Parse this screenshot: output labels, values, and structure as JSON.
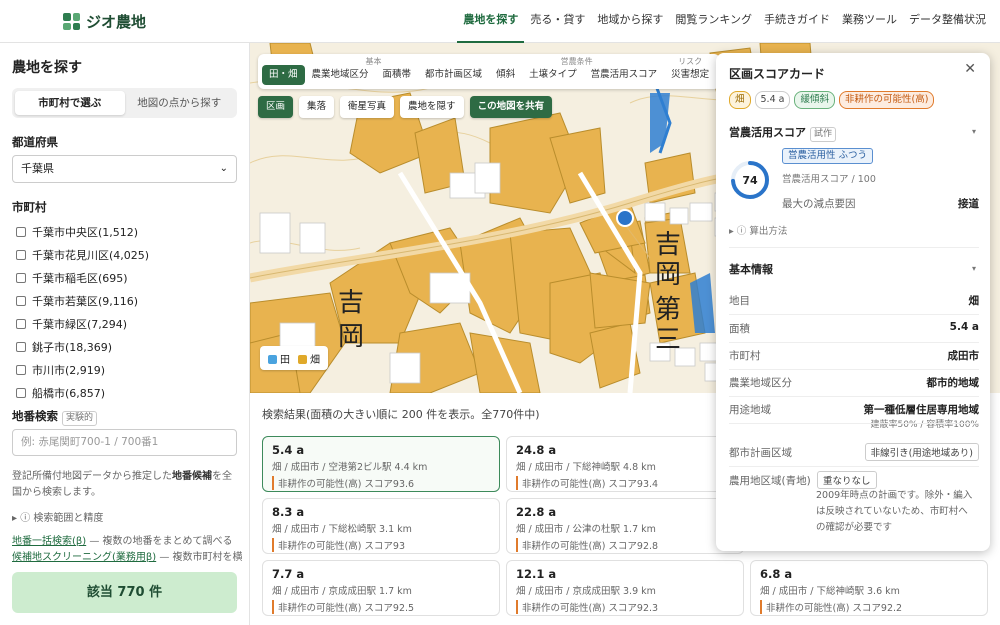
{
  "header": {
    "logo": "ジオ農地",
    "nav": [
      {
        "label": "農地を探す",
        "active": true
      },
      {
        "label": "売る・貸す"
      },
      {
        "label": "地域から探す"
      },
      {
        "label": "閲覧ランキング"
      },
      {
        "label": "手続きガイド"
      },
      {
        "label": "業務ツール"
      },
      {
        "label": "データ整備状況"
      }
    ]
  },
  "sidebar": {
    "title": "農地を探す",
    "modes": [
      "市町村で選ぶ",
      "地図の点から探す"
    ],
    "pref_label": "都道府県",
    "pref_value": "千葉県",
    "city_label": "市町村",
    "cities": [
      "千葉市中央区(1,512)",
      "千葉市花見川区(4,025)",
      "千葉市稲毛区(695)",
      "千葉市若葉区(9,116)",
      "千葉市緑区(7,294)",
      "銚子市(18,369)",
      "市川市(2,919)",
      "船橋市(6,857)"
    ],
    "lot_label": "地番検索",
    "lot_tag": "実験的",
    "lot_placeholder": "例: 赤尾関町700-1 / 700番1",
    "note_pre": "登記所備付地図データから推定した",
    "note_bold": "地番候補",
    "note_post": "を全国から検索します。",
    "detail": "ⓘ 検索範囲と精度",
    "link1": "地番一括検索(β)",
    "link1_rest": " — 複数の地番をまとめて調べる",
    "link2": "候補地スクリーニング(業務用β)",
    "link2_rest": " — 複数市町村を横断して",
    "hits": "該当 770 件"
  },
  "map": {
    "groups": [
      {
        "label": "基本",
        "items": [
          "田・畑",
          "農業地域区分",
          "面積帯",
          "都市計画区域"
        ]
      },
      {
        "label": "営農条件",
        "items": [
          "傾斜",
          "土壌タイプ",
          "営農活用スコア"
        ]
      },
      {
        "label": "リスク",
        "items": [
          "災害想定"
        ]
      }
    ],
    "row2": [
      "区画",
      "集落",
      "衛星写真",
      "農地を隠す",
      "この地図を共有"
    ],
    "labels": [
      "吉",
      "岡",
      "吉",
      "岡",
      "第",
      "三"
    ],
    "legend": [
      {
        "label": "田",
        "color": "#4aa3df"
      },
      {
        "label": "畑",
        "color": "#e0a92a"
      }
    ],
    "field_color": "#e8b34f",
    "water_color": "#2f7fd1",
    "road_color": "#f2d9a6"
  },
  "results": {
    "heading": "検索結果(面積の大きい順に 200 件を表示。全770件中)",
    "cards": [
      {
        "area": "5.4 a",
        "meta": "畑 / 成田市 / 空港第2ビル駅 4.4 km",
        "risk": "非耕作の可能性(高) スコア93.6"
      },
      {
        "area": "24.8 a",
        "meta": "畑 / 成田市 / 下総神崎駅 4.8 km",
        "risk": "非耕作の可能性(高) スコア93.4"
      },
      {
        "area": "8.3 a",
        "meta": "畑 / 成田市 / 下総松崎駅 3.1 km",
        "risk": "非耕作の可能性(高) スコア93"
      },
      {
        "area": "22.8 a",
        "meta": "畑 / 成田市 / 公津の杜駅 1.7 km",
        "risk": "非耕作の可能性(高) スコア92.8"
      },
      {
        "area": "7.7 a",
        "meta": "畑 / 成田市 / 京成成田駅 1.7 km",
        "risk": "非耕作の可能性(高) スコア92.5"
      },
      {
        "area": "12.1 a",
        "meta": "畑 / 成田市 / 京成成田駅 3.9 km",
        "risk": "非耕作の可能性(高) スコア92.3"
      },
      {
        "area": "6.8 a",
        "meta": "畑 / 成田市 / 下総神崎駅 3.6 km",
        "risk": "非耕作の可能性(高) スコア92.2"
      }
    ]
  },
  "panel": {
    "title": "区画スコアカード",
    "badges": [
      "畑",
      "5.4 a",
      "緩傾斜",
      "非耕作の可能性(高)"
    ],
    "score_section": "営農活用スコア",
    "score_tag": "試作",
    "score": 74,
    "score_pill": "営農活用性 ふつう",
    "score_sub": "営農活用スコア / 100",
    "reduce_k": "最大の減点要因",
    "reduce_v": "接道",
    "calc": "ⓘ 算出方法",
    "basic": "基本情報",
    "rows": [
      {
        "k": "地目",
        "v": "畑"
      },
      {
        "k": "面積",
        "v": "5.4 a"
      },
      {
        "k": "市町村",
        "v": "成田市"
      },
      {
        "k": "農業地域区分",
        "v": "都市的地域"
      },
      {
        "k": "用途地域",
        "v": "第一種低層住居専用地域",
        "s": "建蔽率50% / 容積率100%"
      },
      {
        "k": "都市計画区域",
        "v": "非線引き(用途地域あり)"
      },
      {
        "k": "農用地区域(青地)",
        "v": "重なりなし"
      }
    ],
    "note": "2009年時点の計画です。除外・編入は反映されていないため、市町村への確認が必要です"
  }
}
